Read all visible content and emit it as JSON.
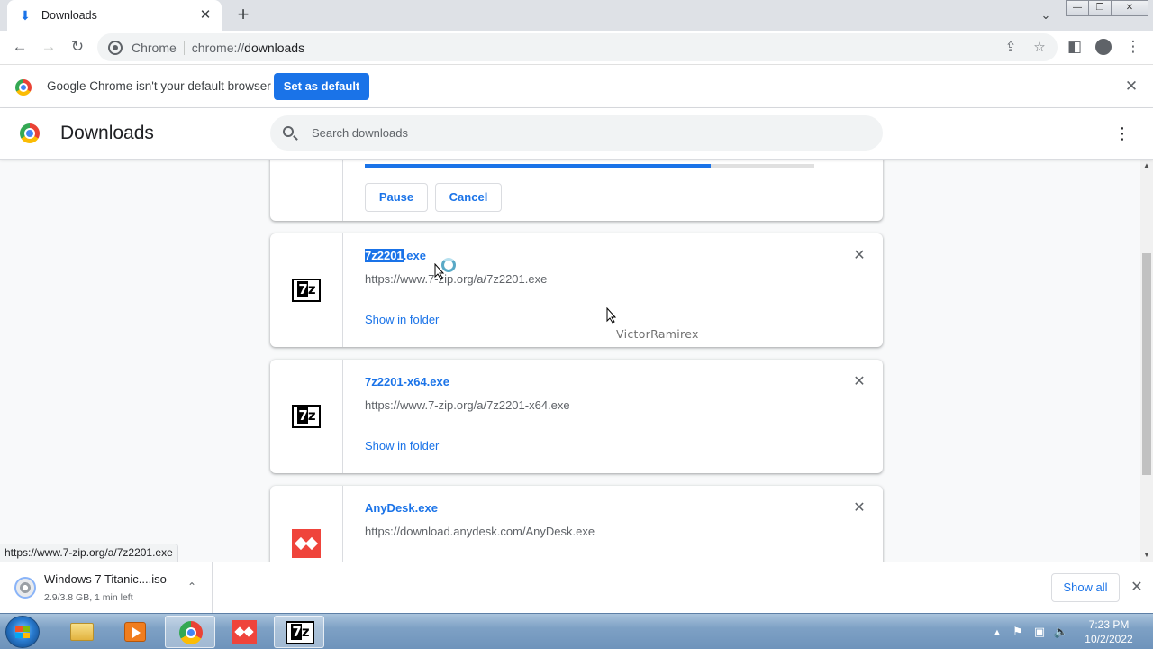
{
  "tab": {
    "title": "Downloads",
    "close_glyph": "✕",
    "icon": "download-icon"
  },
  "new_tab_glyph": "+",
  "window_controls": {
    "minimize": "—",
    "restore": "❐",
    "close": "✕"
  },
  "omnibox": {
    "chip": "Chrome",
    "scheme": "chrome://",
    "host": "downloads"
  },
  "infobar": {
    "message": "Google Chrome isn't your default browser",
    "button": "Set as default",
    "close_glyph": "✕"
  },
  "downloads_page": {
    "title": "Downloads",
    "search_placeholder": "Search downloads",
    "menu_glyph": "⋮"
  },
  "items": [
    {
      "progress_fraction": 0.77,
      "pause": "Pause",
      "cancel": "Cancel"
    },
    {
      "name_selected": "7z2201",
      "name_rest": ".exe",
      "url": "https://www.7-zip.org/a/7z2201.exe",
      "action": "Show in folder",
      "icon": "7zip-icon",
      "icon_text_a": "7",
      "icon_text_b": "z"
    },
    {
      "name": "7z2201-x64.exe",
      "url": "https://www.7-zip.org/a/7z2201-x64.exe",
      "action": "Show in folder",
      "icon": "7zip-icon",
      "icon_text_a": "7",
      "icon_text_b": "z"
    },
    {
      "name": "AnyDesk.exe",
      "url": "https://download.anydesk.com/AnyDesk.exe",
      "icon": "anydesk-icon"
    }
  ],
  "remove_glyph": "✕",
  "watermark": "VictorRamirex",
  "status_url": "https://www.7-zip.org/a/7z2201.exe",
  "shelf": {
    "item_name": "Windows 7 Titanic....iso",
    "item_status": "2.9/3.8 GB, 1 min left",
    "chevron_glyph": "⌃",
    "show_all": "Show all",
    "close_glyph": "✕"
  },
  "taskbar": {
    "time": "7:23 PM",
    "date": "10/2/2022",
    "seven_a": "7",
    "seven_b": "z"
  },
  "colors": {
    "accent": "#1a73e8",
    "anydesk": "#ef443b"
  }
}
